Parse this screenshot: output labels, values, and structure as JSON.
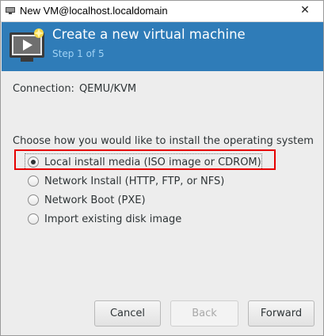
{
  "window": {
    "title": "New VM@localhost.localdomain",
    "close_glyph": "✕"
  },
  "header": {
    "title": "Create a new virtual machine",
    "step": "Step 1 of 5",
    "background_color": "#2f7cb8"
  },
  "connection": {
    "label": "Connection:",
    "value": "QEMU/KVM"
  },
  "install": {
    "question": "Choose how you would like to install the operating system",
    "options": [
      {
        "label": "Local install media (ISO image or CDROM)",
        "selected": true
      },
      {
        "label": "Network Install (HTTP, FTP, or NFS)",
        "selected": false
      },
      {
        "label": "Network Boot (PXE)",
        "selected": false
      },
      {
        "label": "Import existing disk image",
        "selected": false
      }
    ]
  },
  "buttons": {
    "cancel": "Cancel",
    "back": "Back",
    "forward": "Forward"
  },
  "annotation": {
    "highlight_color": "#e60000"
  }
}
